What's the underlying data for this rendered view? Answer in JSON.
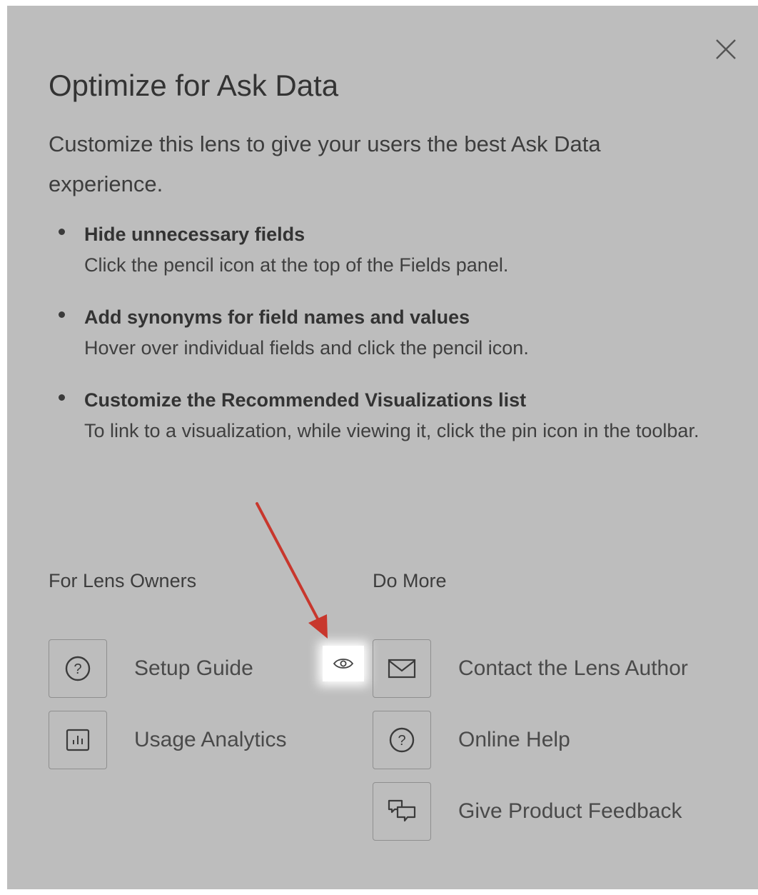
{
  "dialog": {
    "title": "Optimize for Ask Data",
    "subtitle": "Customize this lens to give your users the best Ask Data experience.",
    "close_icon": "close-icon"
  },
  "tips": [
    {
      "heading": "Hide unnecessary fields",
      "body": "Click the pencil icon at the top of the Fields panel."
    },
    {
      "heading": "Add synonyms for field names and values",
      "body": "Hover over individual fields and click the pencil icon."
    },
    {
      "heading": "Customize the Recommended Visualizations list",
      "body": "To link to a visualization, while viewing it, click the pin icon in the toolbar."
    }
  ],
  "lens_owners": {
    "heading": "For Lens Owners",
    "links": [
      {
        "label": "Setup Guide",
        "icon": "question-circle-icon"
      },
      {
        "label": "Usage Analytics",
        "icon": "bar-chart-icon"
      }
    ]
  },
  "do_more": {
    "heading": "Do More",
    "links": [
      {
        "label": "Contact the Lens Author",
        "icon": "envelope-icon"
      },
      {
        "label": "Online Help",
        "icon": "question-circle-icon"
      },
      {
        "label": "Give Product Feedback",
        "icon": "chat-bubbles-icon"
      }
    ]
  },
  "annotation": {
    "highlight_icon": "eye-icon",
    "arrow_color": "#c8372d"
  },
  "colors": {
    "panel_background": "#bdbdbd",
    "text": "#3f3f3f",
    "highlight": "#ffffff"
  }
}
